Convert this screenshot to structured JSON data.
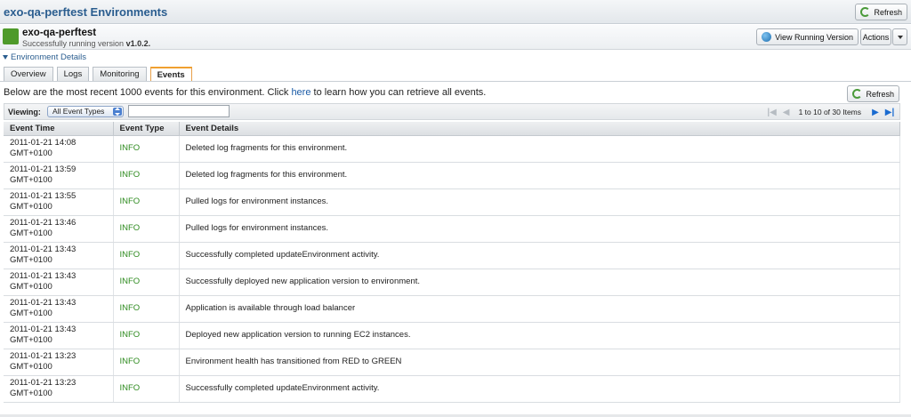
{
  "header": {
    "title": "exo-qa-perftest Environments",
    "refresh_label": "Refresh"
  },
  "environment": {
    "name": "exo-qa-perftest",
    "status_prefix": "Successfully running version",
    "version": "v1.0.2.",
    "health_color": "#4e9a2a",
    "view_running_version_label": "View Running Version",
    "actions_label": "Actions"
  },
  "details_toggle": "Environment Details",
  "tabs": [
    {
      "label": "Overview",
      "active": false
    },
    {
      "label": "Logs",
      "active": false
    },
    {
      "label": "Monitoring",
      "active": false
    },
    {
      "label": "Events",
      "active": true
    }
  ],
  "intro": {
    "before_link": "Below are the most recent 1000 events for this environment. Click ",
    "link_text": "here",
    "after_link": " to learn how you can retrieve all events.",
    "refresh_label": "Refresh"
  },
  "filter": {
    "viewing_label": "Viewing:",
    "event_type_selected": "All Event Types",
    "filter_value": "",
    "pager_label": "1 to 10 of 30 Items"
  },
  "table": {
    "columns": [
      "Event Time",
      "Event Type",
      "Event Details"
    ],
    "rows": [
      {
        "time": "2011-01-21 14:08",
        "tz": "GMT+0100",
        "type": "INFO",
        "details": "Deleted log fragments for this environment."
      },
      {
        "time": "2011-01-21 13:59",
        "tz": "GMT+0100",
        "type": "INFO",
        "details": "Deleted log fragments for this environment."
      },
      {
        "time": "2011-01-21 13:55",
        "tz": "GMT+0100",
        "type": "INFO",
        "details": "Pulled logs for environment instances."
      },
      {
        "time": "2011-01-21 13:46",
        "tz": "GMT+0100",
        "type": "INFO",
        "details": "Pulled logs for environment instances."
      },
      {
        "time": "2011-01-21 13:43",
        "tz": "GMT+0100",
        "type": "INFO",
        "details": "Successfully completed updateEnvironment activity."
      },
      {
        "time": "2011-01-21 13:43",
        "tz": "GMT+0100",
        "type": "INFO",
        "details": "Successfully deployed new application version to environment."
      },
      {
        "time": "2011-01-21 13:43",
        "tz": "GMT+0100",
        "type": "INFO",
        "details": "Application is available through load balancer"
      },
      {
        "time": "2011-01-21 13:43",
        "tz": "GMT+0100",
        "type": "INFO",
        "details": "Deployed new application version to running EC2 instances."
      },
      {
        "time": "2011-01-21 13:23",
        "tz": "GMT+0100",
        "type": "INFO",
        "details": "Environment health has transitioned from RED to GREEN"
      },
      {
        "time": "2011-01-21 13:23",
        "tz": "GMT+0100",
        "type": "INFO",
        "details": "Successfully completed updateEnvironment activity."
      }
    ]
  },
  "icons": {
    "refresh": "refresh-icon",
    "globe": "globe-icon",
    "first_page": "first-page-icon",
    "prev_page": "prev-page-icon",
    "next_page": "next-page-icon",
    "last_page": "last-page-icon"
  },
  "colors": {
    "accent": "#2a5d8f",
    "info": "#2e8b1f",
    "active_tab": "#f0a030",
    "link": "#1a5ba6"
  }
}
